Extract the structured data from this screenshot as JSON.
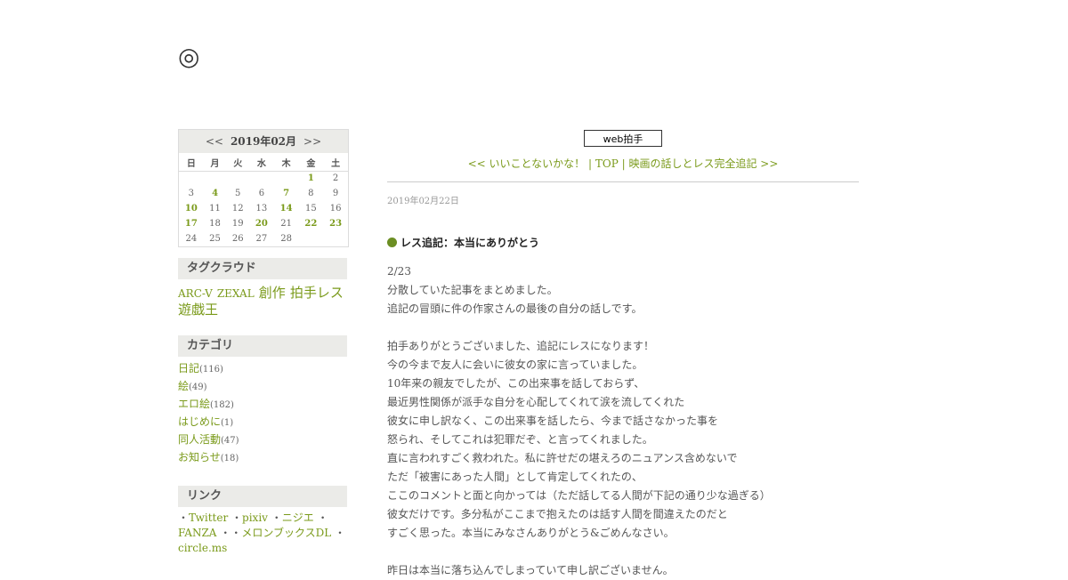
{
  "site": {
    "title": "◎"
  },
  "calendar": {
    "prev": "<<",
    "next": ">>",
    "month_label": "2019年02月",
    "weekdays": [
      "日",
      "月",
      "火",
      "水",
      "木",
      "金",
      "土"
    ],
    "weeks": [
      [
        {
          "d": ""
        },
        {
          "d": ""
        },
        {
          "d": ""
        },
        {
          "d": ""
        },
        {
          "d": ""
        },
        {
          "d": "1",
          "link": true
        },
        {
          "d": "2"
        }
      ],
      [
        {
          "d": "3"
        },
        {
          "d": "4",
          "link": true
        },
        {
          "d": "5"
        },
        {
          "d": "6"
        },
        {
          "d": "7",
          "link": true
        },
        {
          "d": "8"
        },
        {
          "d": "9"
        }
      ],
      [
        {
          "d": "10",
          "link": true
        },
        {
          "d": "11"
        },
        {
          "d": "12"
        },
        {
          "d": "13"
        },
        {
          "d": "14",
          "link": true
        },
        {
          "d": "15"
        },
        {
          "d": "16"
        }
      ],
      [
        {
          "d": "17",
          "link": true
        },
        {
          "d": "18"
        },
        {
          "d": "19"
        },
        {
          "d": "20",
          "link": true
        },
        {
          "d": "21"
        },
        {
          "d": "22",
          "link": true
        },
        {
          "d": "23",
          "link": true
        }
      ],
      [
        {
          "d": "24"
        },
        {
          "d": "25"
        },
        {
          "d": "26"
        },
        {
          "d": "27"
        },
        {
          "d": "28"
        },
        {
          "d": ""
        },
        {
          "d": ""
        }
      ]
    ]
  },
  "tagcloud": {
    "heading": "タグクラウド",
    "tags": [
      {
        "label": "ARC-V",
        "size": "s"
      },
      {
        "label": "ZEXAL",
        "size": "s"
      },
      {
        "label": "創作",
        "size": "l"
      },
      {
        "label": "拍手レス",
        "size": "l"
      },
      {
        "label": "遊戯王",
        "size": "l"
      }
    ]
  },
  "categories": {
    "heading": "カテゴリ",
    "items": [
      {
        "label": "日記",
        "count": "(116)"
      },
      {
        "label": "絵",
        "count": "(49)"
      },
      {
        "label": "エロ絵",
        "count": "(182)"
      },
      {
        "label": "はじめに",
        "count": "(1)"
      },
      {
        "label": "同人活動",
        "count": "(47)"
      },
      {
        "label": "お知らせ",
        "count": "(18)"
      }
    ]
  },
  "links": {
    "heading": "リンク",
    "items": [
      "Twitter",
      "pixiv",
      "ニジエ",
      "FANZA",
      "メロンブックスDL",
      "circle.ms"
    ],
    "separator": "・"
  },
  "main": {
    "clap_label": "web拍手",
    "nav": {
      "prev": "<< いいことないかな！",
      "sep": " | ",
      "top": "TOP",
      "next": "映画の話しとレス完全追記 >>"
    },
    "date": "2019年02月22日",
    "entry_title": "レス追記：本当にありがとう",
    "lines": [
      "2/23",
      "分散していた記事をまとめました。",
      "追記の冒頭に件の作家さんの最後の自分の話しです。",
      "",
      "拍手ありがとうございました、追記にレスになります！",
      "今の今まで友人に会いに彼女の家に言っていました。",
      "10年来の親友でしたが、この出来事を話しておらず、",
      "最近男性関係が派手な自分を心配してくれて涙を流してくれた",
      "彼女に申し訳なく、この出来事を話したら、今まで話さなかった事を",
      "怒られ、そしてこれは犯罪だぞ、と言ってくれました。",
      "直に言われすごく救われた。私に許せだの堪えろのニュアンス含めないで",
      "ただ「被害にあった人間」として肯定してくれたの、",
      "ここのコメントと面と向かっては（ただ話してる人間が下記の通り少な過ぎる）",
      "彼女だけです。多分私がここまで抱えたのは話す人間を間違えたのだと",
      "すごく思った。本当にみなさんありがとう&ごめんなさい。",
      "",
      "昨日は本当に落ち込んでしまっていて申し訳ございません。"
    ]
  }
}
